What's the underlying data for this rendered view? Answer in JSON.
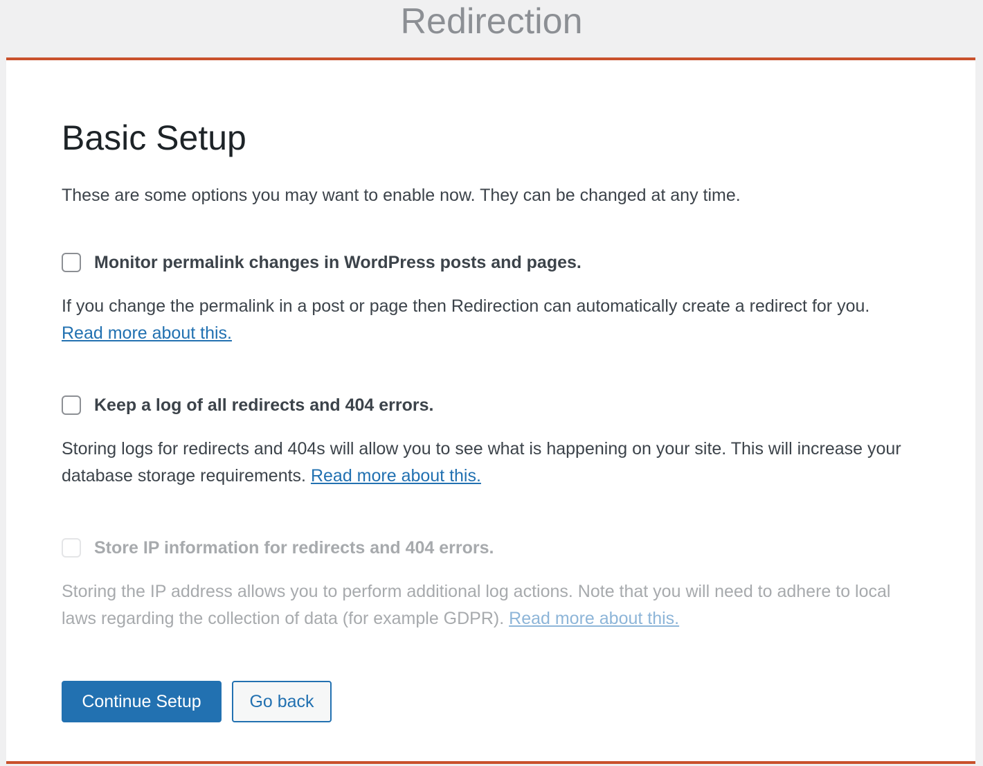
{
  "app": {
    "title": "Redirection"
  },
  "setup": {
    "heading": "Basic Setup",
    "intro": "These are some options you may want to enable now. They can be changed at any time.",
    "options": [
      {
        "label": "Monitor permalink changes in WordPress posts and pages.",
        "description": "If you change the permalink in a post or page then Redirection can automatically create a redirect for you.",
        "link": "Read more about this.",
        "checked": false,
        "disabled": false
      },
      {
        "label": "Keep a log of all redirects and 404 errors.",
        "description": "Storing logs for redirects and 404s will allow you to see what is happening on your site. This will increase your database storage requirements.",
        "link": "Read more about this.",
        "checked": false,
        "disabled": false
      },
      {
        "label": "Store IP information for redirects and 404 errors.",
        "description": "Storing the IP address allows you to perform additional log actions. Note that you will need to adhere to local laws regarding the collection of data (for example GDPR).",
        "link": "Read more about this.",
        "checked": false,
        "disabled": true
      }
    ]
  },
  "actions": {
    "continue_label": "Continue Setup",
    "back_label": "Go back"
  },
  "colors": {
    "accent_border": "#c9512c",
    "primary": "#2271b1",
    "text": "#3c434a",
    "heading": "#1d2327",
    "muted": "#a7aaad",
    "background": "#f0f0f1"
  }
}
